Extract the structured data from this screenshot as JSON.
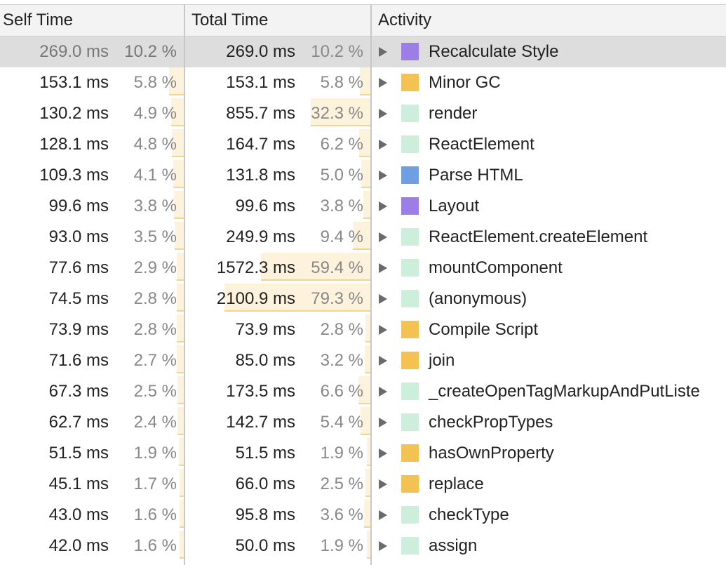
{
  "columns": {
    "self": "Self Time",
    "total": "Total Time",
    "activity": "Activity"
  },
  "colors": {
    "purple": "#9c7ee6",
    "yellow": "#f3c252",
    "green": "#cdeedb",
    "blue": "#6f9ee3"
  },
  "icons": {
    "expand": "expand-triangle-icon"
  },
  "selected_index": 0,
  "rows": [
    {
      "self_ms": "269.0 ms",
      "self_pct": "10.2 %",
      "self_frac": 0.102,
      "total_ms": "269.0 ms",
      "total_pct": "10.2 %",
      "total_frac": 0.102,
      "name": "Recalculate Style",
      "color": "purple"
    },
    {
      "self_ms": "153.1 ms",
      "self_pct": "5.8 %",
      "self_frac": 0.058,
      "total_ms": "153.1 ms",
      "total_pct": "5.8 %",
      "total_frac": 0.058,
      "name": "Minor GC",
      "color": "yellow"
    },
    {
      "self_ms": "130.2 ms",
      "self_pct": "4.9 %",
      "self_frac": 0.049,
      "total_ms": "855.7 ms",
      "total_pct": "32.3 %",
      "total_frac": 0.323,
      "name": "render",
      "color": "green"
    },
    {
      "self_ms": "128.1 ms",
      "self_pct": "4.8 %",
      "self_frac": 0.048,
      "total_ms": "164.7 ms",
      "total_pct": "6.2 %",
      "total_frac": 0.062,
      "name": "ReactElement",
      "color": "green"
    },
    {
      "self_ms": "109.3 ms",
      "self_pct": "4.1 %",
      "self_frac": 0.041,
      "total_ms": "131.8 ms",
      "total_pct": "5.0 %",
      "total_frac": 0.05,
      "name": "Parse HTML",
      "color": "blue"
    },
    {
      "self_ms": "99.6 ms",
      "self_pct": "3.8 %",
      "self_frac": 0.038,
      "total_ms": "99.6 ms",
      "total_pct": "3.8 %",
      "total_frac": 0.038,
      "name": "Layout",
      "color": "purple"
    },
    {
      "self_ms": "93.0 ms",
      "self_pct": "3.5 %",
      "self_frac": 0.035,
      "total_ms": "249.9 ms",
      "total_pct": "9.4 %",
      "total_frac": 0.094,
      "name": "ReactElement.createElement",
      "color": "green"
    },
    {
      "self_ms": "77.6 ms",
      "self_pct": "2.9 %",
      "self_frac": 0.029,
      "total_ms": "1572.3 ms",
      "total_pct": "59.4 %",
      "total_frac": 0.594,
      "name": "mountComponent",
      "color": "green"
    },
    {
      "self_ms": "74.5 ms",
      "self_pct": "2.8 %",
      "self_frac": 0.028,
      "total_ms": "2100.9 ms",
      "total_pct": "79.3 %",
      "total_frac": 0.793,
      "name": "(anonymous)",
      "color": "green"
    },
    {
      "self_ms": "73.9 ms",
      "self_pct": "2.8 %",
      "self_frac": 0.028,
      "total_ms": "73.9 ms",
      "total_pct": "2.8 %",
      "total_frac": 0.028,
      "name": "Compile Script",
      "color": "yellow"
    },
    {
      "self_ms": "71.6 ms",
      "self_pct": "2.7 %",
      "self_frac": 0.027,
      "total_ms": "85.0 ms",
      "total_pct": "3.2 %",
      "total_frac": 0.032,
      "name": "join",
      "color": "yellow"
    },
    {
      "self_ms": "67.3 ms",
      "self_pct": "2.5 %",
      "self_frac": 0.025,
      "total_ms": "173.5 ms",
      "total_pct": "6.6 %",
      "total_frac": 0.066,
      "name": "_createOpenTagMarkupAndPutListe",
      "color": "green"
    },
    {
      "self_ms": "62.7 ms",
      "self_pct": "2.4 %",
      "self_frac": 0.024,
      "total_ms": "142.7 ms",
      "total_pct": "5.4 %",
      "total_frac": 0.054,
      "name": "checkPropTypes",
      "color": "green"
    },
    {
      "self_ms": "51.5 ms",
      "self_pct": "1.9 %",
      "self_frac": 0.019,
      "total_ms": "51.5 ms",
      "total_pct": "1.9 %",
      "total_frac": 0.019,
      "name": "hasOwnProperty",
      "color": "yellow"
    },
    {
      "self_ms": "45.1 ms",
      "self_pct": "1.7 %",
      "self_frac": 0.017,
      "total_ms": "66.0 ms",
      "total_pct": "2.5 %",
      "total_frac": 0.025,
      "name": "replace",
      "color": "yellow"
    },
    {
      "self_ms": "43.0 ms",
      "self_pct": "1.6 %",
      "self_frac": 0.016,
      "total_ms": "95.8 ms",
      "total_pct": "3.6 %",
      "total_frac": 0.036,
      "name": "checkType",
      "color": "green"
    },
    {
      "self_ms": "42.0 ms",
      "self_pct": "1.6 %",
      "self_frac": 0.016,
      "total_ms": "50.0 ms",
      "total_pct": "1.9 %",
      "total_frac": 0.019,
      "name": "assign",
      "color": "green"
    }
  ]
}
